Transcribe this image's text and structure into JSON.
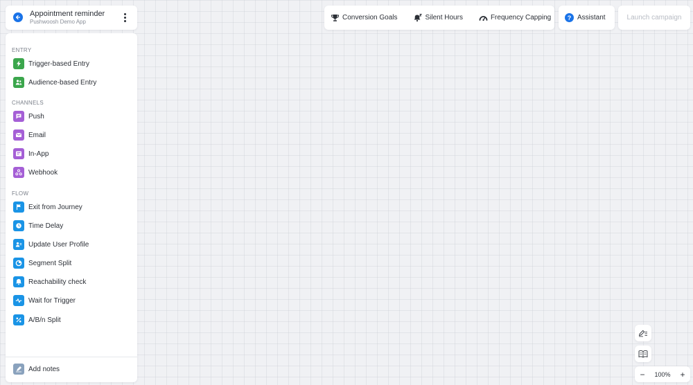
{
  "header": {
    "title": "Appointment reminder",
    "subtitle": "Pushwoosh Demo App"
  },
  "sidebar": {
    "sections": [
      {
        "label": "ENTRY",
        "items": [
          {
            "label": "Trigger-based Entry",
            "icon": "lightning-icon",
            "color": "#3ba64c"
          },
          {
            "label": "Audience-based Entry",
            "icon": "audience-icon",
            "color": "#3ba64c"
          }
        ]
      },
      {
        "label": "CHANNELS",
        "items": [
          {
            "label": "Push",
            "icon": "push-icon",
            "color": "#a55fd6"
          },
          {
            "label": "Email",
            "icon": "email-icon",
            "color": "#a55fd6"
          },
          {
            "label": "In-App",
            "icon": "in-app-icon",
            "color": "#a55fd6"
          },
          {
            "label": "Webhook",
            "icon": "webhook-icon",
            "color": "#a55fd6"
          }
        ]
      },
      {
        "label": "FLOW",
        "items": [
          {
            "label": "Exit from Journey",
            "icon": "flag-icon",
            "color": "#1a94e6"
          },
          {
            "label": "Time Delay",
            "icon": "clock-icon",
            "color": "#1a94e6"
          },
          {
            "label": "Update User Profile",
            "icon": "user-profile-icon",
            "color": "#1a94e6"
          },
          {
            "label": "Segment Split",
            "icon": "segment-icon",
            "color": "#1a94e6"
          },
          {
            "label": "Reachability check",
            "icon": "bell-check-icon",
            "color": "#1a94e6"
          },
          {
            "label": "Wait for Trigger",
            "icon": "pulse-icon",
            "color": "#1a94e6"
          },
          {
            "label": "A/B/n Split",
            "icon": "percent-icon",
            "color": "#1a94e6"
          }
        ]
      }
    ],
    "add_notes": {
      "label": "Add notes",
      "icon": "notes-icon",
      "color": "#8aa2bd"
    }
  },
  "toolbar": {
    "conversion_goals": "Conversion Goals",
    "silent_hours": "Silent Hours",
    "frequency_capping": "Frequency Capping",
    "assistant": "Assistant",
    "launch_campaign": "Launch campaign"
  },
  "zoom": {
    "value": "100%",
    "minus": "−",
    "plus": "+"
  },
  "colors": {
    "accent": "#1a73e8",
    "entry": "#3ba64c",
    "channels": "#a55fd6",
    "flow": "#1a94e6",
    "canvas": "#f0f1f4"
  }
}
